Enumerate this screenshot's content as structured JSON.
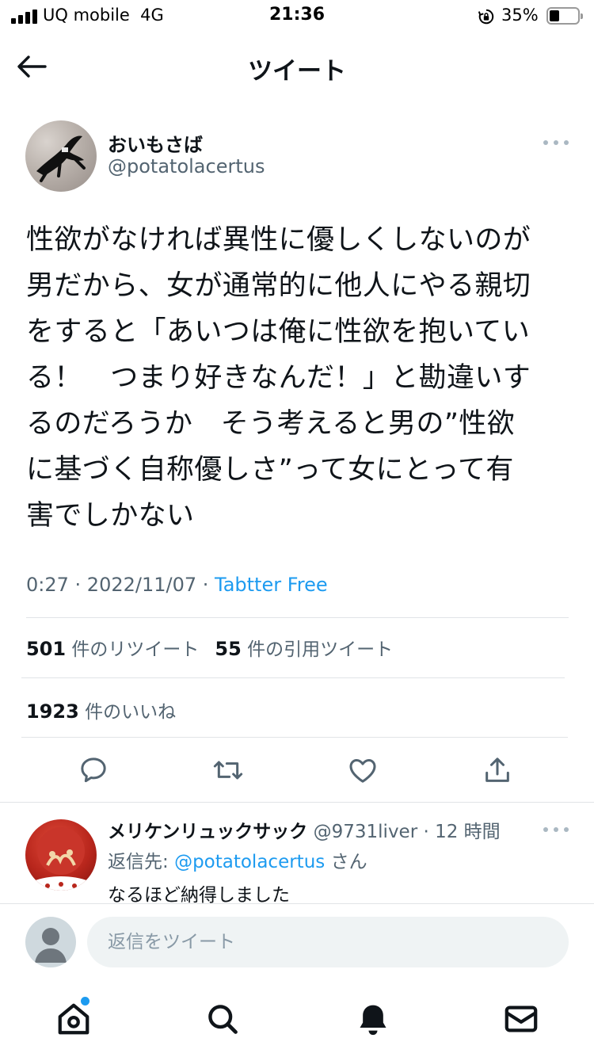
{
  "status_bar": {
    "carrier": "UQ mobile",
    "network": "4G",
    "time": "21:36",
    "battery_percent": "35%",
    "battery_level": 0.35
  },
  "nav": {
    "title": "ツイート",
    "back_icon": "arrow-left-icon"
  },
  "tweet": {
    "author_name": "おいもさば",
    "author_handle": "@potatolacertus",
    "text_lines": [
      "性欲がなければ異性に優しくしないのが",
      "男だから、女が通常的に他人にやる親切",
      "をすると「あいつは俺に性欲を抱いてい",
      "る！　つまり好きなんだ！」と勘違いす",
      "るのだろうか　そう考えると男の”性欲",
      "に基づく自称優しさ”って女にとって有",
      "害でしかない"
    ],
    "time": "0:27",
    "date": "2022/11/07",
    "source": "Tabtter Free",
    "separator": " · "
  },
  "stats": {
    "retweets_count": "501",
    "retweets_label": "件のリツイート",
    "quotes_count": "55",
    "quotes_label": "件の引用ツイート",
    "likes_count": "1923",
    "likes_label": "件のいいね"
  },
  "actions": {
    "reply_icon": "comment-icon",
    "retweet_icon": "retweet-icon",
    "like_icon": "heart-icon",
    "share_icon": "share-icon"
  },
  "reply": {
    "name": "メリケンリュックサック",
    "handle": "@9731liver",
    "separator": " · ",
    "time": "12 時間",
    "reply_to_label": "返信先: ",
    "reply_to_handle": "@potatolacertus",
    "reply_to_suffix": " さん",
    "text": "なるほど納得しました"
  },
  "compose": {
    "placeholder": "返信をツイート"
  },
  "tab_bar": {
    "items": [
      "home-icon",
      "search-icon",
      "notifications-icon",
      "messages-icon"
    ],
    "home_has_badge": true
  },
  "colors": {
    "accent": "#1d9bf0",
    "text_primary": "#0f1419",
    "text_secondary": "#536471",
    "divider": "#e1e4e7"
  }
}
